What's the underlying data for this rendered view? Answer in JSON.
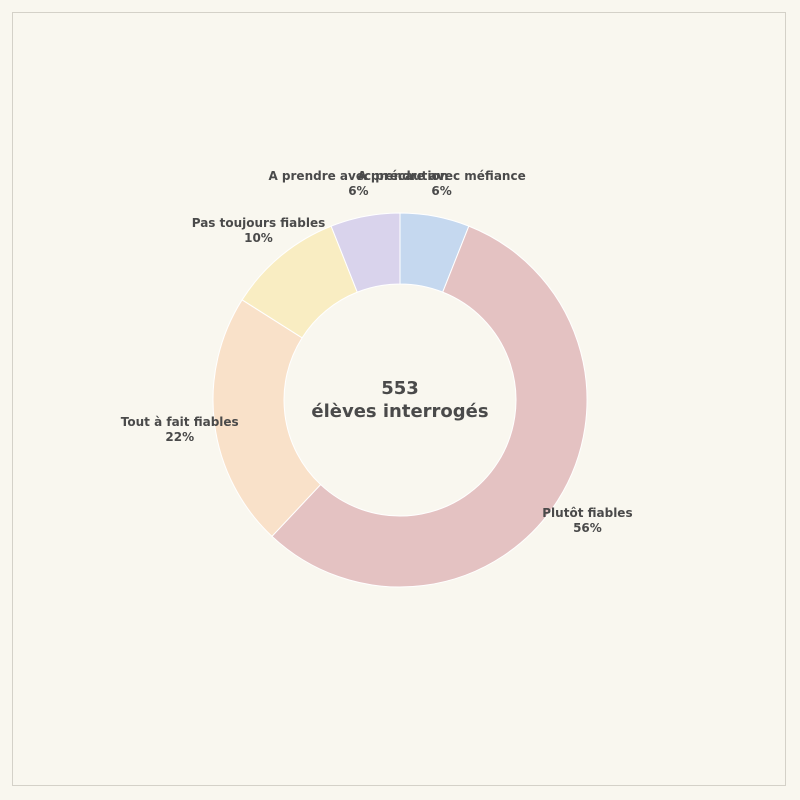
{
  "chart_data": {
    "type": "pie",
    "center_text": [
      "553",
      "élèves interrogés"
    ],
    "slices": [
      {
        "label": "A prendre avec méfiance",
        "value": 6,
        "value_label": "6%",
        "color": "#c5d8ef"
      },
      {
        "label": "Plutôt fiables",
        "value": 56,
        "value_label": "56%",
        "color": "#e4c2c2"
      },
      {
        "label": "Tout à fait fiables",
        "value": 22,
        "value_label": "22%",
        "color": "#f9e1c9"
      },
      {
        "label": "Pas toujours fiables",
        "value": 10,
        "value_label": "10%",
        "color": "#f9edc2"
      },
      {
        "label": "A prendre avec précaution",
        "value": 6,
        "value_label": "6%",
        "color": "#d9d3ec"
      }
    ]
  }
}
